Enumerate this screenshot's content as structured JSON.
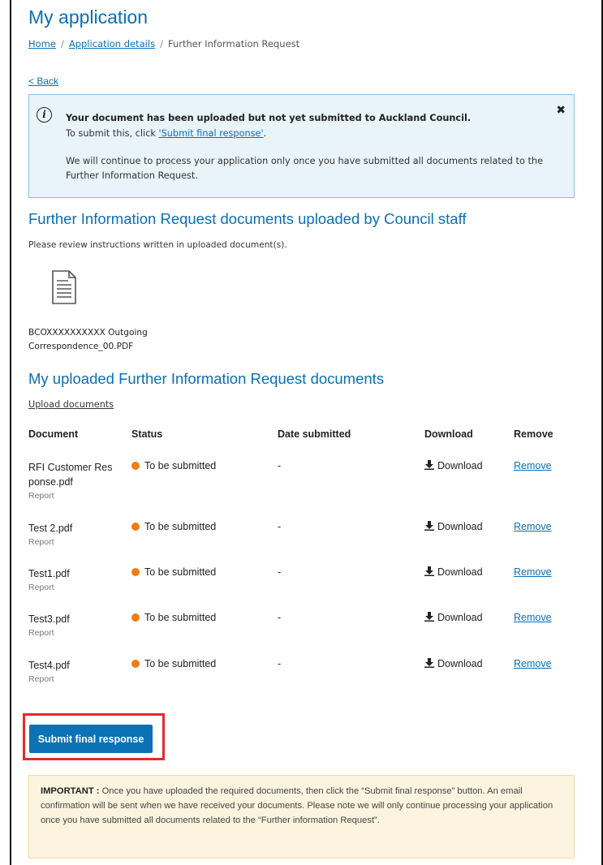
{
  "page": {
    "title": "My application",
    "breadcrumb": [
      "Home",
      "Application details",
      "Further Information Request"
    ],
    "back_label": "< Back"
  },
  "notice": {
    "headline": "Your document has been uploaded but not yet submitted to Auckland Council.",
    "line2_prefix": "To submit this, click ",
    "line2_link": "'Submit final response'",
    "line2_suffix": ".",
    "line3": "We will continue to process your application only once you have submitted all documents related to the",
    "line4": "Further Information Request.",
    "close_icon": "close-icon"
  },
  "council_docs": {
    "heading": "Further Information Request documents uploaded by Council staff",
    "instructions": "Please review instructions written in uploaded document(s).",
    "file_line1": "BCOXXXXXXXXXX Outgoing",
    "file_line2": "Correspondence_00.PDF"
  },
  "my_docs": {
    "heading": "My uploaded Further Information Request documents",
    "upload_link": "Upload documents",
    "columns": [
      "Document",
      "Status",
      "Date submitted",
      "Download",
      "Remove"
    ],
    "rows": [
      {
        "name": "RFI Customer Res ponse.pdf",
        "type": "Report",
        "status": "To be submitted",
        "date": "-",
        "download": "Download",
        "remove": "Remove"
      },
      {
        "name": "Test 2.pdf",
        "type": "Report",
        "status": "To be submitted",
        "date": "-",
        "download": "Download",
        "remove": "Remove"
      },
      {
        "name": "Test1.pdf",
        "type": "Report",
        "status": "To be submitted",
        "date": "-",
        "download": "Download",
        "remove": "Remove"
      },
      {
        "name": "Test3.pdf",
        "type": "Report",
        "status": "To be submitted",
        "date": "-",
        "download": "Download",
        "remove": "Remove"
      },
      {
        "name": "Test4.pdf",
        "type": "Report",
        "status": "To be submitted",
        "date": "-",
        "download": "Download",
        "remove": "Remove"
      }
    ]
  },
  "submit_label": "Submit final response",
  "important": {
    "label": "IMPORTANT :",
    "text": "Once you have uploaded the required documents, then click the “Submit final response” button. An email confirmation will be sent when we have received your documents. Please note we will only continue processing your application once you have submitted all documents related to the “Further information Request”."
  },
  "colors": {
    "accent": "#0b6fb5",
    "status_dot": "#f07d12",
    "notice_bg": "#e8f3fa",
    "important_bg": "#fcf4de",
    "highlight": "#e32b2b"
  }
}
